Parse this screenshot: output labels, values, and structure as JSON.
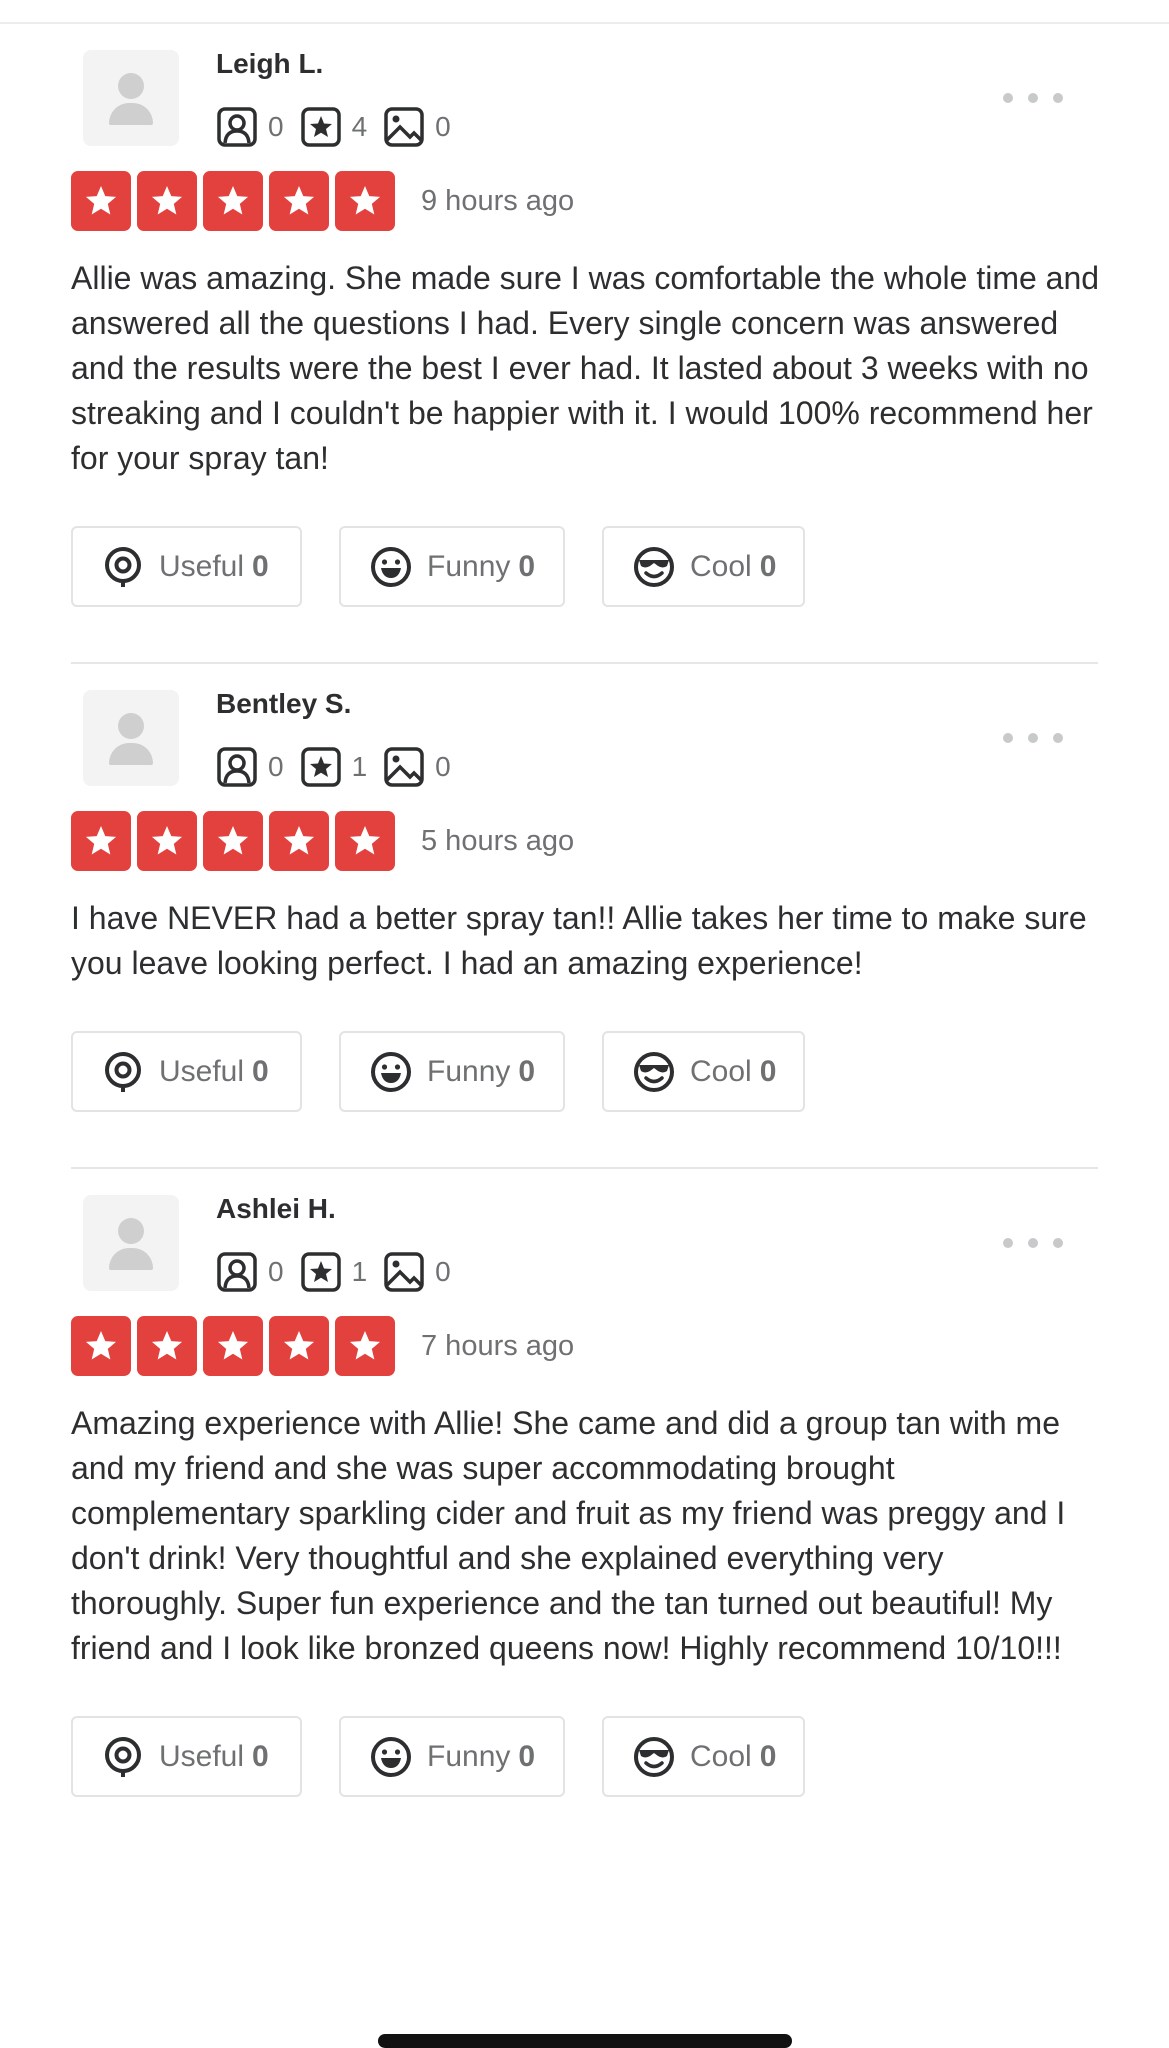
{
  "reviews": [
    {
      "user": {
        "name": "Leigh L.",
        "friends": "0",
        "reviews": "4",
        "photos": "0"
      },
      "rating": 5,
      "time": "9 hours ago",
      "text": "Allie was amazing. She made sure I was comfortable the whole time and answered all the questions I had. Every single concern was answered and the results were the best I ever had. It lasted about 3 weeks with no streaking and I couldn't be happier with it. I would 100% recommend her for your spray tan!",
      "reactions": {
        "useful_label": "Useful",
        "useful": "0",
        "funny_label": "Funny",
        "funny": "0",
        "cool_label": "Cool",
        "cool": "0"
      }
    },
    {
      "user": {
        "name": "Bentley S.",
        "friends": "0",
        "reviews": "1",
        "photos": "0"
      },
      "rating": 5,
      "time": "5 hours ago",
      "text": "I have NEVER had a better spray tan!! Allie takes her time to make sure you leave looking perfect. I had an amazing experience!",
      "reactions": {
        "useful_label": "Useful",
        "useful": "0",
        "funny_label": "Funny",
        "funny": "0",
        "cool_label": "Cool",
        "cool": "0"
      }
    },
    {
      "user": {
        "name": "Ashlei H.",
        "friends": "0",
        "reviews": "1",
        "photos": "0"
      },
      "rating": 5,
      "time": "7 hours ago",
      "text": "Amazing experience with Allie! She came and did a group tan with me and my friend and she was super accommodating brought complementary sparkling cider and fruit as my friend was preggy and I don't drink! Very thoughtful and she explained everything very thoroughly. Super fun experience and the tan turned out beautiful! My friend and I look like bronzed queens now! Highly recommend 10/10!!!",
      "reactions": {
        "useful_label": "Useful",
        "useful": "0",
        "funny_label": "Funny",
        "funny": "0",
        "cool_label": "Cool",
        "cool": "0"
      }
    }
  ],
  "colors": {
    "star_fill": "#e2413e",
    "muted_text": "#6e7072",
    "body_text": "#2d2e2f"
  },
  "icons": [
    "avatar-placeholder-icon",
    "friends-icon",
    "reviews-star-icon",
    "photos-icon",
    "more-options-icon",
    "star-icon",
    "useful-icon",
    "funny-icon",
    "cool-icon"
  ]
}
